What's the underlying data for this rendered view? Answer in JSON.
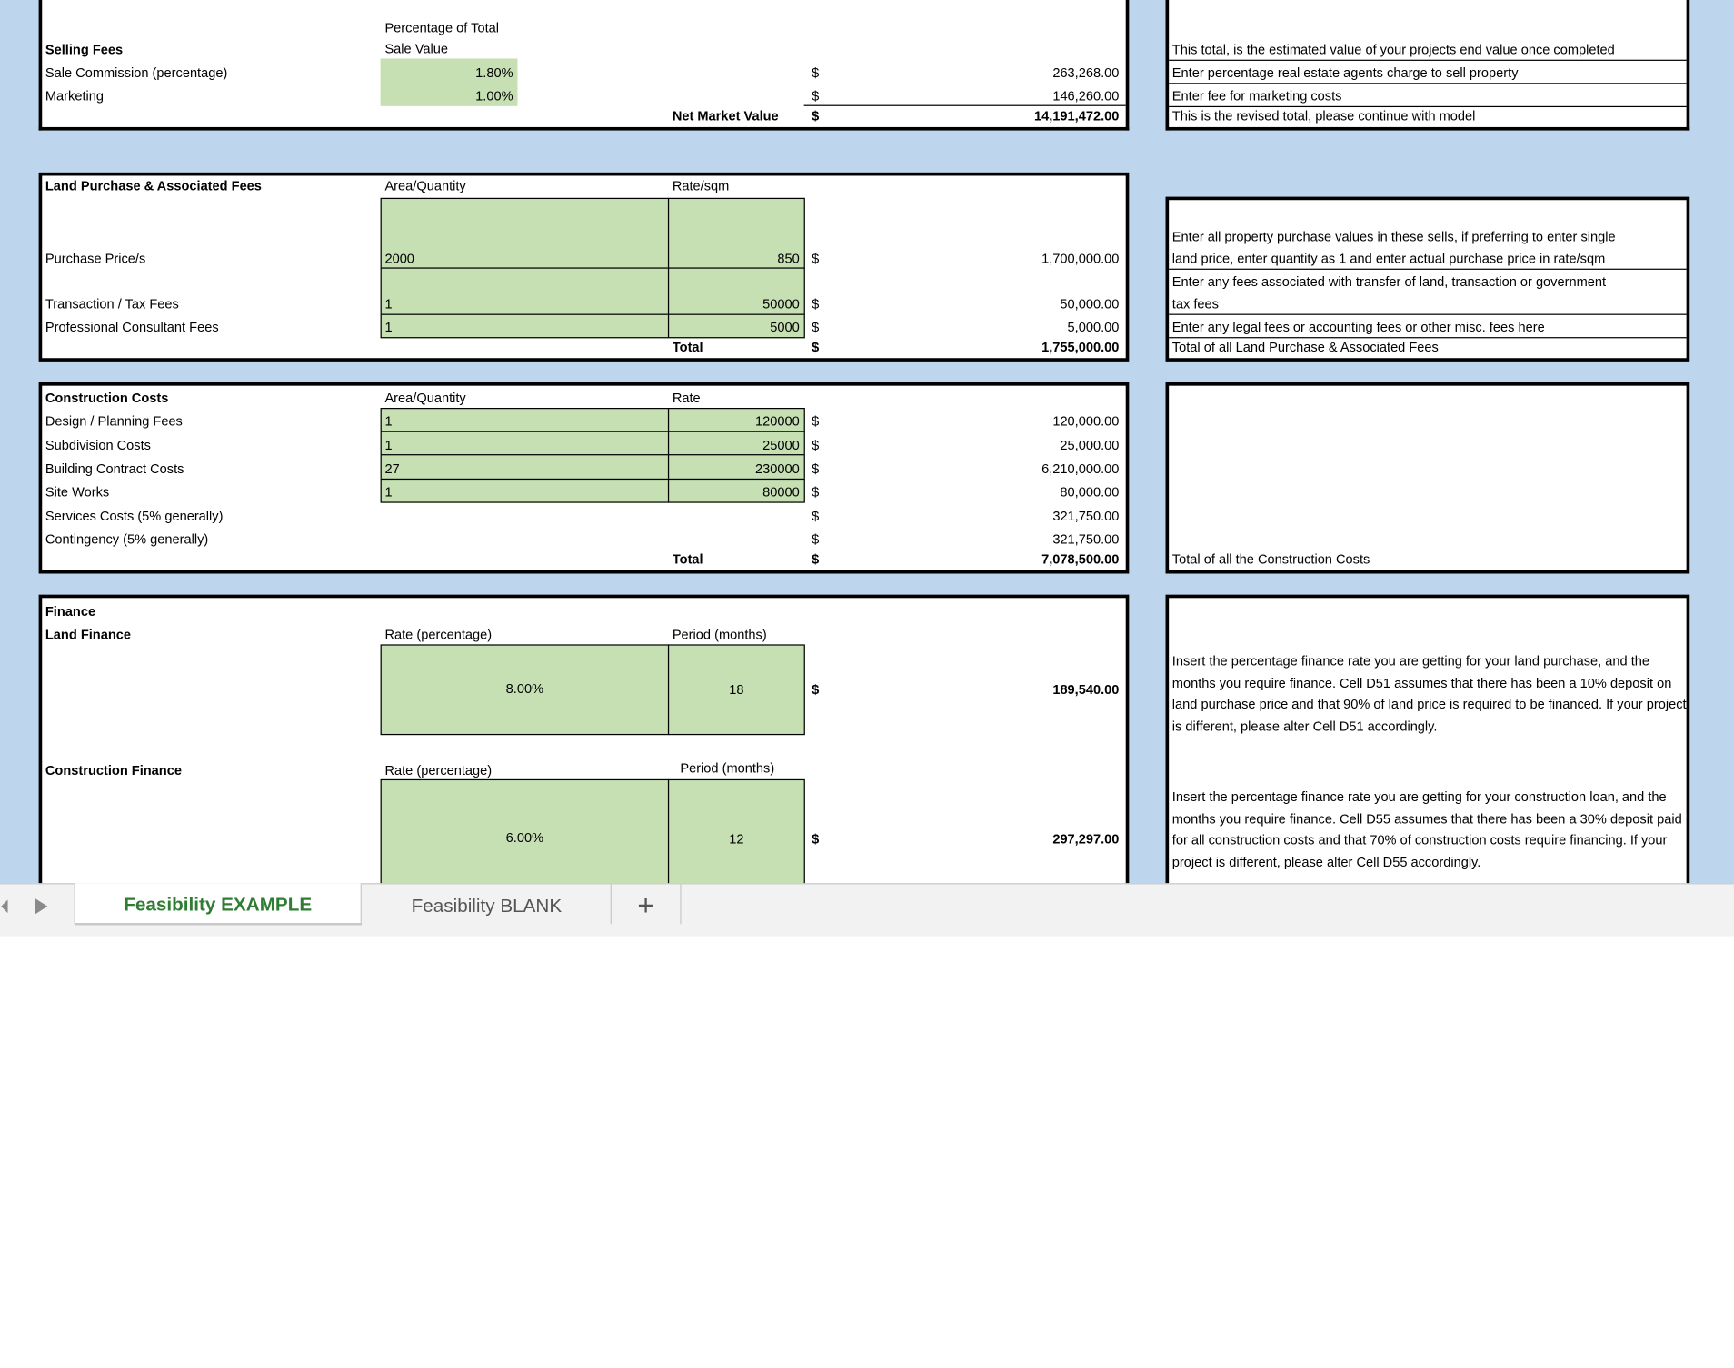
{
  "selling": {
    "title": "Selling Fees",
    "col_header_line1": "Percentage of Total",
    "col_header_line2": "Sale Value",
    "rows": [
      {
        "label": "Sale Commission (percentage)",
        "pct": "1.80%",
        "cur": "$",
        "amount": "263,268.00",
        "note": "Enter percentage real estate agents charge to sell property"
      },
      {
        "label": "Marketing",
        "pct": "1.00%",
        "cur": "$",
        "amount": "146,260.00",
        "note": "Enter fee for marketing costs"
      }
    ],
    "top_note": "This total, is the estimated value of your projects end value once completed",
    "total_label": "Net Market Value",
    "total_cur": "$",
    "total_amount": "14,191,472.00",
    "total_note": "This is the revised total, please continue with model"
  },
  "land": {
    "title": "Land Purchase & Associated Fees",
    "col1": "Area/Quantity",
    "col2": "Rate/sqm",
    "rows": [
      {
        "label": "Purchase Price/s",
        "qty": "2000",
        "rate": "850",
        "cur": "$",
        "amount": "1,700,000.00"
      },
      {
        "label": "Transaction / Tax Fees",
        "qty": "1",
        "rate": "50000",
        "cur": "$",
        "amount": "50,000.00"
      },
      {
        "label": "Professional Consultant Fees",
        "qty": "1",
        "rate": "5000",
        "cur": "$",
        "amount": "5,000.00"
      }
    ],
    "total_label": "Total",
    "total_cur": "$",
    "total_amount": "1,755,000.00",
    "notes": {
      "purchase_1": "Enter all property purchase values in these sells, if preferring to enter single",
      "purchase_2": "land price, enter quantity as 1 and enter actual purchase price in rate/sqm",
      "transaction_1": "Enter any fees associated with transfer of land, transaction or government",
      "transaction_2": "tax fees",
      "professional": "Enter any legal fees or accounting fees or other misc. fees here",
      "total": "Total of all Land Purchase & Associated Fees"
    }
  },
  "construction": {
    "title": "Construction Costs",
    "col1": "Area/Quantity",
    "col2": "Rate",
    "rows": [
      {
        "label": "Design / Planning Fees",
        "qty": "1",
        "rate": "120000",
        "cur": "$",
        "amount": "120,000.00"
      },
      {
        "label": "Subdivision Costs",
        "qty": "1",
        "rate": "25000",
        "cur": "$",
        "amount": "25,000.00"
      },
      {
        "label": "Building Contract Costs",
        "qty": "27",
        "rate": "230000",
        "cur": "$",
        "amount": "6,210,000.00"
      },
      {
        "label": "Site Works",
        "qty": "1",
        "rate": "80000",
        "cur": "$",
        "amount": "80,000.00"
      },
      {
        "label": "Services Costs (5% generally)",
        "qty": "",
        "rate": "",
        "cur": "$",
        "amount": "321,750.00"
      },
      {
        "label": "Contingency (5% generally)",
        "qty": "",
        "rate": "",
        "cur": "$",
        "amount": "321,750.00"
      }
    ],
    "total_label": "Total",
    "total_cur": "$",
    "total_amount": "7,078,500.00",
    "total_note": "Total of all the Construction Costs"
  },
  "finance": {
    "title": "Finance",
    "land": {
      "label": "Land Finance",
      "rate_header": "Rate (percentage)",
      "period_header": "Period (months)",
      "rate": "8.00%",
      "period": "18",
      "cur": "$",
      "amount": "189,540.00",
      "note": "Insert the percentage finance rate you are getting for your land purchase, and the months you require finance. Cell D51 assumes that there has been a 10% deposit on land purchase price and that 90% of land price is required to be financed. If your project is different, please alter Cell D51 accordingly."
    },
    "construction": {
      "label": "Construction Finance",
      "rate_header": "Rate (percentage)",
      "period_header": "Period (months)",
      "rate": "6.00%",
      "period": "12",
      "cur": "$",
      "amount": "297,297.00",
      "note": "Insert the percentage finance rate you are getting for your construction loan, and the months you require finance. Cell D55 assumes that there has been a 30% deposit paid for all construction costs and that 70% of construction costs require financing. If your project is different, please alter Cell D55 accordingly."
    }
  },
  "tabs": {
    "active": "Feasibility EXAMPLE",
    "other": "Feasibility BLANK",
    "add": "+"
  },
  "colors": {
    "input_fill": "#c6e0b4",
    "background_band": "#bdd6ed",
    "active_tab_text": "#2e7d32"
  }
}
